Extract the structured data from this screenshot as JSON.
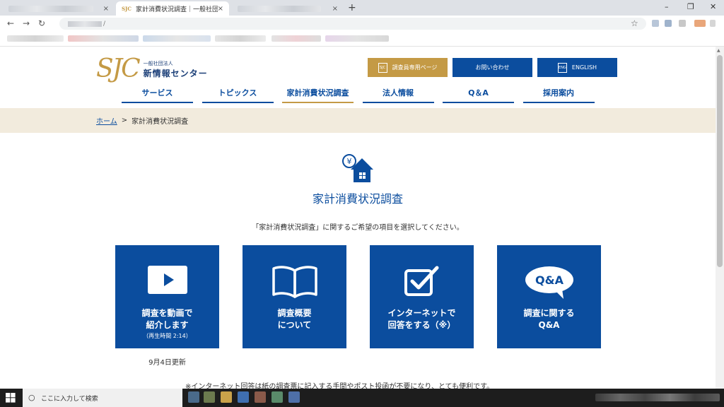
{
  "browser": {
    "active_tab_title": "家計消費状況調査｜一般社団法人",
    "active_tab_favicon": "SJC",
    "close_glyph": "×",
    "new_tab_glyph": "+",
    "address_fragment": "/",
    "back_glyph": "←",
    "forward_glyph": "→",
    "reload_glyph": "↻",
    "star_glyph": "☆",
    "minimize_glyph": "–",
    "maximize_glyph": "❐",
    "window_close_glyph": "✕"
  },
  "header": {
    "logo_mark": "SJC",
    "logo_small": "一般社団法人",
    "logo_main": "新情報センター",
    "buttons": [
      {
        "label": "調査員専用ページ",
        "icon": "sjc-badge-icon",
        "icon_text": "SJC"
      },
      {
        "label": "お問い合わせ"
      },
      {
        "label": "ENGLISH",
        "icon": "english-badge-icon",
        "icon_text": "ENG"
      }
    ]
  },
  "nav": {
    "items": [
      {
        "label": "サービス"
      },
      {
        "label": "トピックス"
      },
      {
        "label": "家計消費状況調査"
      },
      {
        "label": "法人情報"
      },
      {
        "label": "Q＆A"
      },
      {
        "label": "採用案内"
      }
    ],
    "current_index": 2
  },
  "breadcrumb": {
    "home": "ホーム",
    "separator": ">",
    "current": "家計消費状況調査"
  },
  "main": {
    "title": "家計消費状況調査",
    "lead": "「家計消費状況調査」に関するご希望の項目を選択してください。",
    "cards": [
      {
        "line1": "調査を動画で",
        "line2": "紹介します",
        "sub": "（再生時間 2:14）",
        "icon": "play-video-icon"
      },
      {
        "line1": "調査概要",
        "line2": "について",
        "icon": "open-book-icon"
      },
      {
        "line1": "インターネットで",
        "line2": "回答をする（※）",
        "icon": "checkbox-icon"
      },
      {
        "line1": "調査に関する",
        "line2": "Q&A",
        "icon": "qa-bubble-icon",
        "icon_text": "Q&A"
      }
    ],
    "updated": "9月4日更新",
    "note": "※インターネット回答は紙の調査票に記入する手間やポスト投函が不要になり、とても便利です。"
  },
  "taskbar": {
    "search_placeholder": "ここに入力して検索"
  },
  "colors": {
    "brand_blue": "#0b4d9e",
    "brand_gold": "#c49a45",
    "crumb_bg": "#f2ebdd"
  }
}
